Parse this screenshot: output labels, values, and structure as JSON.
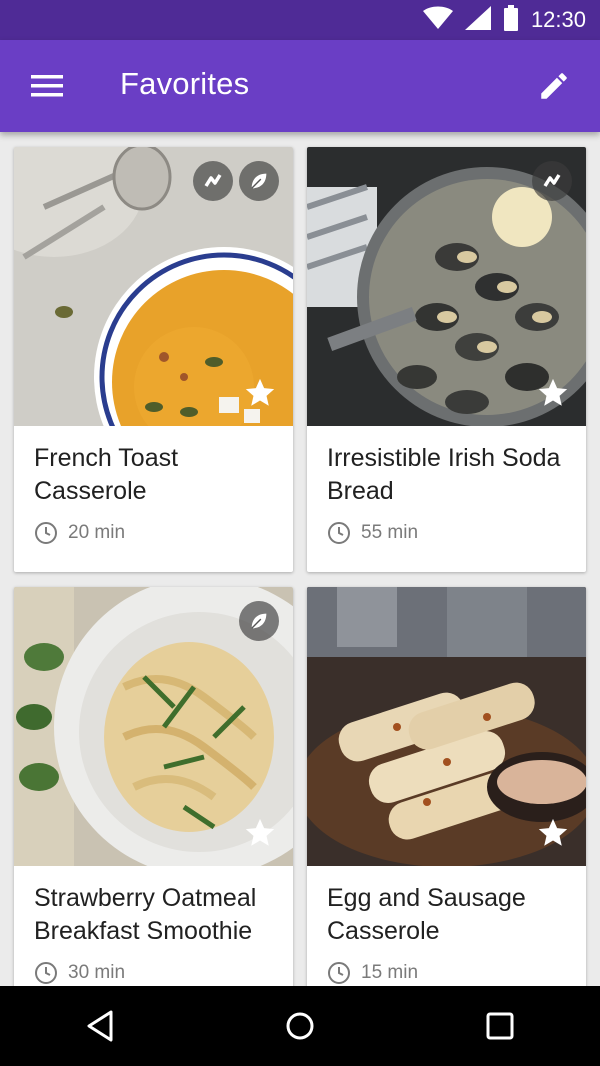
{
  "status_bar": {
    "time": "12:30"
  },
  "app_bar": {
    "title": "Favorites"
  },
  "recipes": [
    {
      "name": "French Toast Casserole",
      "time": "20 min",
      "badges": [
        "bean-icon",
        "leaf-icon"
      ],
      "favorite": true
    },
    {
      "name": "Irresistible Irish Soda Bread",
      "time": "55 min",
      "badges": [
        "bean-icon"
      ],
      "favorite": true
    },
    {
      "name": "Strawberry Oatmeal Breakfast Smoothie",
      "time": "30 min",
      "badges": [
        "leaf-icon"
      ],
      "favorite": true
    },
    {
      "name": "Egg and Sausage Casserole",
      "time": "15 min",
      "badges": [],
      "favorite": true
    }
  ],
  "colors": {
    "status_bar": "#4f2b96",
    "app_bar": "#6a3ec5",
    "background": "#ebebeb"
  }
}
